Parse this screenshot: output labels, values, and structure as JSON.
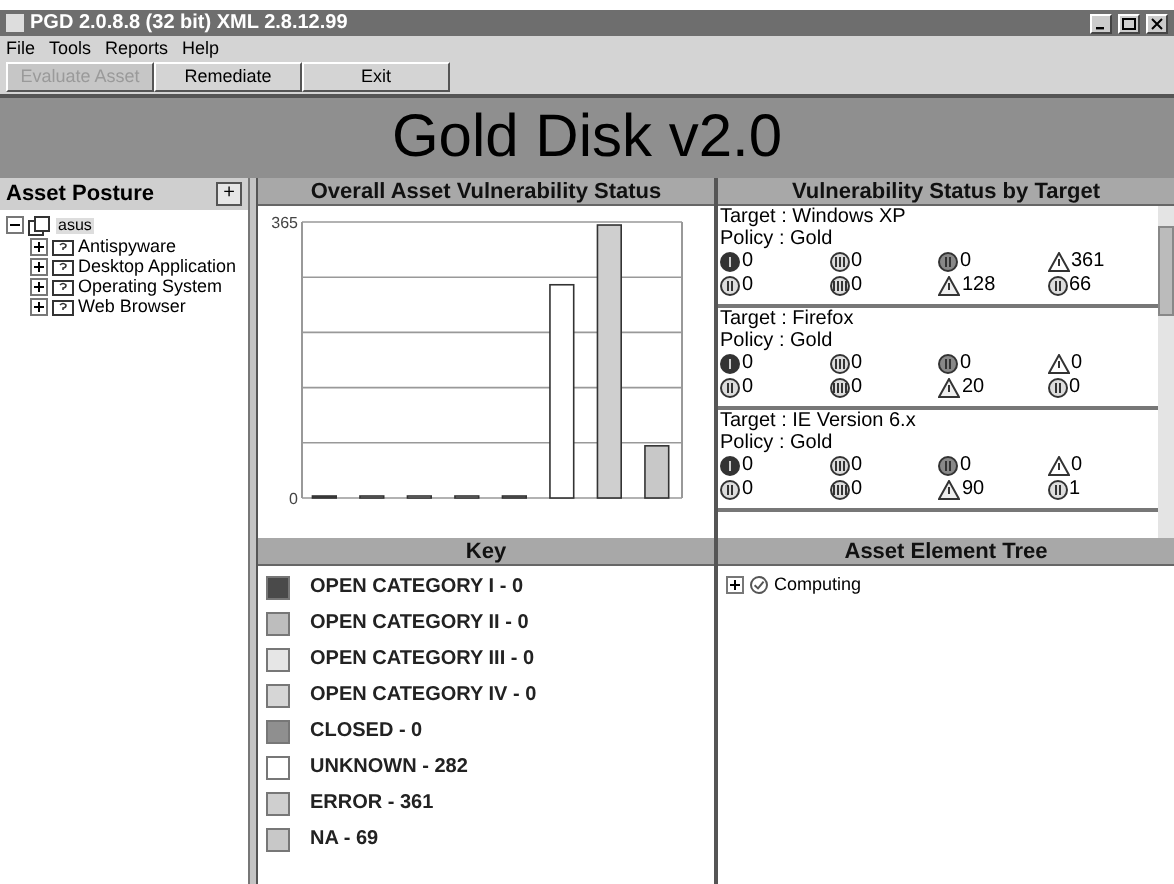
{
  "window": {
    "title": "PGD 2.0.8.8 (32 bit) XML 2.8.12.99"
  },
  "menu": [
    "File",
    "Tools",
    "Reports",
    "Help"
  ],
  "toolbar": [
    {
      "label": "Evaluate Asset",
      "disabled": true
    },
    {
      "label": "Remediate",
      "disabled": false
    },
    {
      "label": "Exit",
      "disabled": false
    }
  ],
  "banner": "Gold Disk v2.0",
  "asset_posture": {
    "title": "Asset Posture",
    "expand_button": "+",
    "tree": [
      {
        "label": "asus",
        "expanded": true,
        "selected": true,
        "children": [
          {
            "label": "Antispyware",
            "expanded": false,
            "selected": false
          },
          {
            "label": "Desktop Application",
            "expanded": false,
            "selected": false
          },
          {
            "label": "Operating System",
            "expanded": false,
            "selected": false
          },
          {
            "label": "Web Browser",
            "expanded": false,
            "selected": false
          }
        ]
      }
    ]
  },
  "overall_status": {
    "title": "Overall Asset Vulnerability Status",
    "chart_data": {
      "type": "bar",
      "values": [
        0,
        0,
        0,
        0,
        0,
        282,
        361,
        69
      ],
      "ylim": [
        0,
        365
      ],
      "yticks": [
        0,
        365
      ]
    }
  },
  "status_by_target": {
    "title": "Vulnerability Status by Target",
    "targets": [
      {
        "target": "Target : Windows XP",
        "policy": "Policy : Gold",
        "counts": [
          {
            "kind": "cat1",
            "value": "0"
          },
          {
            "kind": "cat3",
            "value": "0"
          },
          {
            "kind": "closed",
            "value": "0"
          },
          {
            "kind": "error",
            "value": "361"
          },
          {
            "kind": "cat2",
            "value": "0"
          },
          {
            "kind": "cat4",
            "value": "0"
          },
          {
            "kind": "unknown",
            "value": "128"
          },
          {
            "kind": "na",
            "value": "66"
          }
        ]
      },
      {
        "target": "Target : Firefox",
        "policy": "Policy : Gold",
        "counts": [
          {
            "kind": "cat1",
            "value": "0"
          },
          {
            "kind": "cat3",
            "value": "0"
          },
          {
            "kind": "closed",
            "value": "0"
          },
          {
            "kind": "error",
            "value": "0"
          },
          {
            "kind": "cat2",
            "value": "0"
          },
          {
            "kind": "cat4",
            "value": "0"
          },
          {
            "kind": "unknown",
            "value": "20"
          },
          {
            "kind": "na",
            "value": "0"
          }
        ]
      },
      {
        "target": "Target : IE Version 6.x",
        "policy": "Policy : Gold",
        "counts": [
          {
            "kind": "cat1",
            "value": "0"
          },
          {
            "kind": "cat3",
            "value": "0"
          },
          {
            "kind": "closed",
            "value": "0"
          },
          {
            "kind": "error",
            "value": "0"
          },
          {
            "kind": "cat2",
            "value": "0"
          },
          {
            "kind": "cat4",
            "value": "0"
          },
          {
            "kind": "unknown",
            "value": "90"
          },
          {
            "kind": "na",
            "value": "1"
          }
        ]
      }
    ]
  },
  "key": {
    "title": "Key",
    "items": [
      {
        "label": "OPEN CATEGORY I - 0",
        "color": "#4a4a4a"
      },
      {
        "label": "OPEN CATEGORY II - 0",
        "color": "#bdbdbd"
      },
      {
        "label": "OPEN CATEGORY III - 0",
        "color": "#e6e6e6"
      },
      {
        "label": "OPEN CATEGORY IV - 0",
        "color": "#d6d6d6"
      },
      {
        "label": "CLOSED - 0",
        "color": "#8f8f8f"
      },
      {
        "label": "UNKNOWN - 282",
        "color": "#ffffff"
      },
      {
        "label": "ERROR - 361",
        "color": "#cfcfcf"
      },
      {
        "label": "NA - 69",
        "color": "#c8c8c8"
      }
    ]
  },
  "asset_element_tree": {
    "title": "Asset Element Tree",
    "items": [
      {
        "label": "Computing",
        "expanded": false
      }
    ]
  }
}
